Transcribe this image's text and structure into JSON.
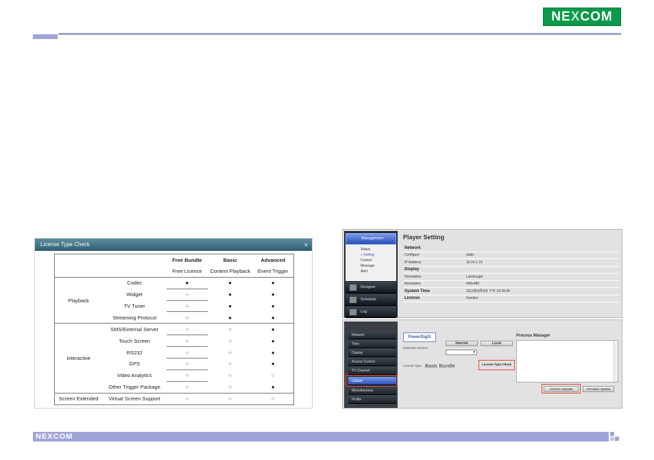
{
  "header": {
    "logo": {
      "part1": "NE",
      "part2": "X",
      "part3": "COM"
    }
  },
  "footer": {
    "logo": "NEXCOM"
  },
  "license_dialog": {
    "title": "License Type Check",
    "close": "×",
    "columns": [
      {
        "name": "Free Bundle",
        "sub": "Free Licence"
      },
      {
        "name": "Basic",
        "sub": "Content Playback"
      },
      {
        "name": "Advanced",
        "sub": "Event Trigger"
      }
    ],
    "groups": [
      {
        "name": "Playback",
        "rows": [
          {
            "feature": "Codec",
            "values": [
              "●",
              "●",
              "●"
            ]
          },
          {
            "feature": "Widget",
            "values": [
              "○",
              "●",
              "●"
            ]
          },
          {
            "feature": "TV Tuner",
            "values": [
              "○",
              "●",
              "●"
            ]
          },
          {
            "feature": "Streaming Protocol",
            "values": [
              "○",
              "●",
              "●"
            ]
          }
        ]
      },
      {
        "name": "Interactive",
        "rows": [
          {
            "feature": "SMS/External Server",
            "values": [
              "○",
              "○",
              "●"
            ]
          },
          {
            "feature": "Touch Screen",
            "values": [
              "○",
              "○",
              "●"
            ]
          },
          {
            "feature": "RS232",
            "values": [
              "○",
              "○",
              "●"
            ]
          },
          {
            "feature": "GPS",
            "values": [
              "○",
              "○",
              "●"
            ]
          },
          {
            "feature": "Video Analytics",
            "values": [
              "○",
              "○",
              "○"
            ]
          },
          {
            "feature": "Other Trigger Package",
            "values": [
              "○",
              "○",
              "●"
            ]
          }
        ]
      },
      {
        "name": "Screen Extended",
        "rows": [
          {
            "feature": "Virtual Screen Support",
            "values": [
              "○",
              "○",
              "○"
            ]
          }
        ]
      }
    ]
  },
  "player_setting": {
    "sidebar": {
      "management": "Management",
      "sub_items": [
        "Status",
        "» Setting",
        "Control",
        "Message",
        "Alert"
      ],
      "nav": [
        "Designer",
        "Schedule",
        "Log"
      ]
    },
    "title": "Player Setting",
    "rows": [
      {
        "key": "Network",
        "value": "",
        "header": true
      },
      {
        "key": "Configure",
        "value": "static",
        "header": false
      },
      {
        "key": "IP Address",
        "value": "10.14.1.15",
        "header": false
      },
      {
        "key": "Display",
        "value": "",
        "header": true
      },
      {
        "key": "Orientation",
        "value": "Landscape",
        "header": false
      },
      {
        "key": "Resolution",
        "value": "640x480",
        "header": false
      },
      {
        "key": "System Time",
        "value": "2012年4月5日 下午 03:35:06",
        "header": true
      },
      {
        "key": "License",
        "value": "Inactive",
        "header": true
      }
    ]
  },
  "update_panel": {
    "sidebar": [
      "Network",
      "Time",
      "Display",
      "Access Control",
      "TV Channel",
      "Update",
      "Miscellaneous",
      "Profile"
    ],
    "active": "Update",
    "logo": "PowerDigiS",
    "tabs": [
      "Internet",
      "Local"
    ],
    "external_service_label": "Extension Service",
    "select_value": "▾",
    "license_type_label": "License Type",
    "license_type_value": "Basic Bundle",
    "license_type_check": "License Type Check",
    "process_manager": "Process Manager",
    "license_upgrade": "License Upgrade",
    "firmware_update": "Firmware Update"
  }
}
